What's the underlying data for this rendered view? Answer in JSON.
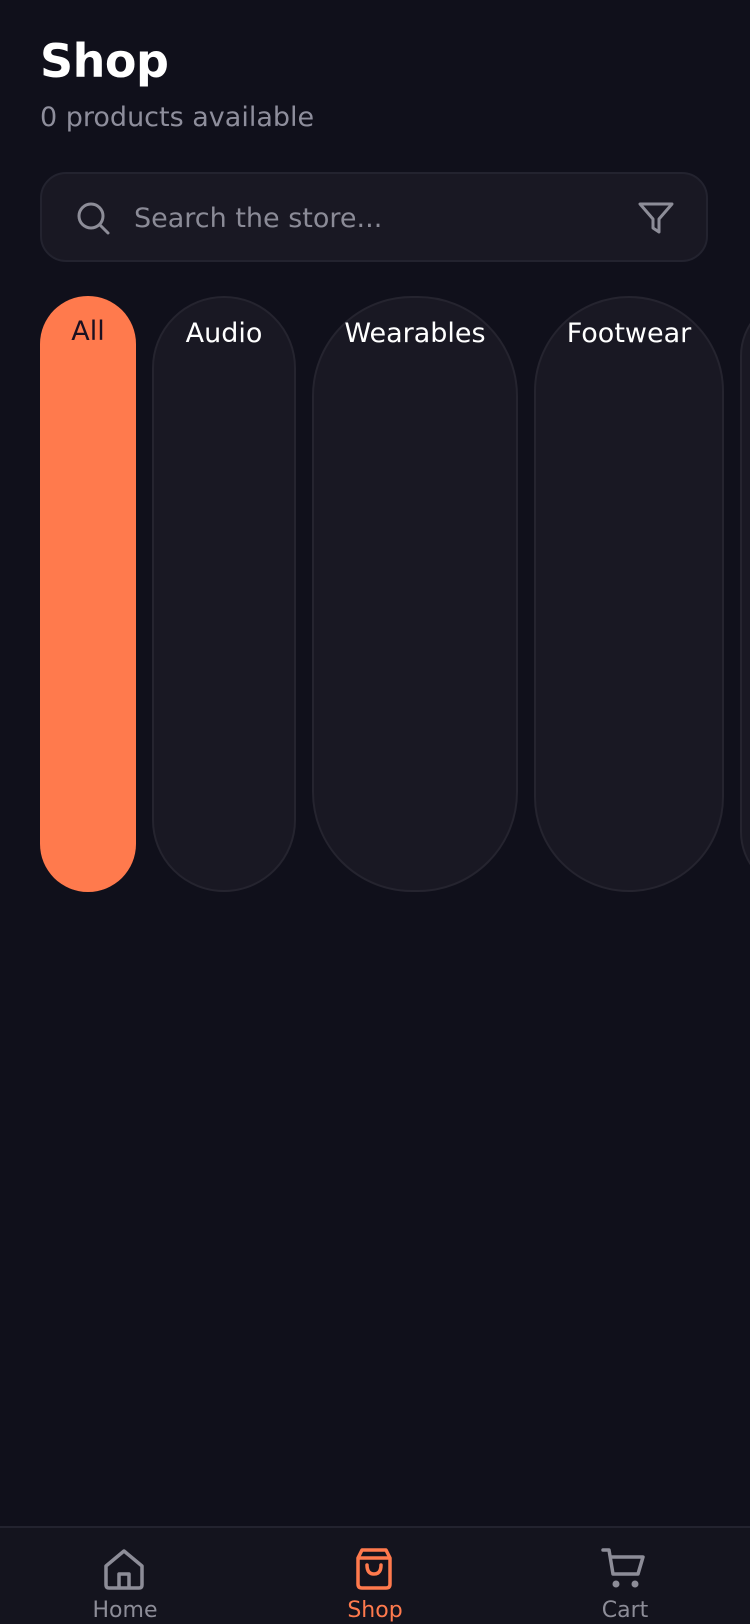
{
  "header": {
    "title": "Shop",
    "subtitle": "0 products available"
  },
  "search": {
    "placeholder": "Search the store...",
    "value": ""
  },
  "categories": [
    {
      "label": "All",
      "active": true
    },
    {
      "label": "Audio",
      "active": false
    },
    {
      "label": "Wearables",
      "active": false
    },
    {
      "label": "Footwear",
      "active": false
    }
  ],
  "tab_bar": {
    "items": [
      {
        "label": "Home",
        "icon": "home-icon",
        "active": false
      },
      {
        "label": "Shop",
        "icon": "shopping-bag-icon",
        "active": true
      },
      {
        "label": "Cart",
        "icon": "cart-icon",
        "active": false
      }
    ]
  },
  "colors": {
    "background": "#10101b",
    "accent": "#ff7a4d",
    "card": "#191823",
    "muted_text": "#8e8e9c",
    "inactive_icon": "#8d8d98"
  }
}
